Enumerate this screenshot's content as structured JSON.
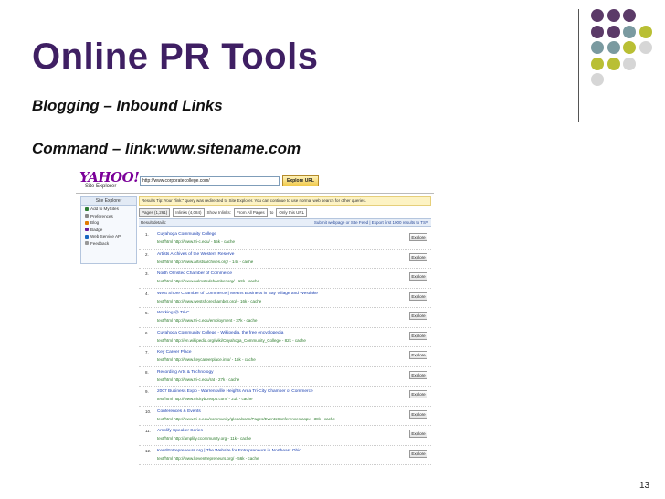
{
  "slide": {
    "title": "Online PR Tools",
    "subtitle1": "Blogging – Inbound Links",
    "subtitle2": "Command – link:www.sitename.com",
    "page_number": "13"
  },
  "decor": {
    "dot_colors": [
      [
        "#5b3a68",
        "#5b3a68",
        "#5b3a68",
        null
      ],
      [
        "#5b3a68",
        "#5b3a68",
        "#7a9aa0",
        "#b9bf34"
      ],
      [
        "#7a9aa0",
        "#7a9aa0",
        "#b9bf34",
        "#d6d6d6"
      ],
      [
        "#b9bf34",
        "#b9bf34",
        "#d6d6d6",
        null
      ],
      [
        "#d6d6d6",
        null,
        null,
        null
      ]
    ]
  },
  "screenshot": {
    "logo_word": "YAHOO!",
    "logo_sub": "Site Explorer",
    "url_value": "http://www.corporatecollege.com/",
    "explore_url_label": "Explore URL",
    "nav_title": "Site Explorer",
    "nav_items": [
      {
        "label": "Add to MySites",
        "color": "#2e7d32"
      },
      {
        "label": "Preferences",
        "color": "#888888"
      },
      {
        "label": "Blog",
        "color": "#e07a00"
      },
      {
        "label": "Badge",
        "color": "#6a1b9a"
      },
      {
        "label": "Web Service API",
        "color": "#1565c0"
      },
      {
        "label": "Feedback",
        "color": "#999999"
      }
    ],
    "results_notice": "Results   Tip: Your \"link:\" query was redirected to Site Explorer. You can continue to use normal web search for other queries.",
    "tabs": [
      "Pages (1,261)",
      "Inlinks (4,084)"
    ],
    "show_inlinks_label": "Show Inlinks:",
    "show_inlinks_value": "From All Pages",
    "to_label": "to",
    "scope_value": "Only this URL",
    "details_label": "Result details:",
    "details_right": "Submit webpage or Site Feed | Export first 1000 results to TSV",
    "results": [
      {
        "num": "1.",
        "title": "Cuyahoga Community College",
        "url": "text/html http://www.tri-c.edu/ - 55k - cache"
      },
      {
        "num": "2.",
        "title": "Artists Archives of the Western Reserve",
        "url": "text/html http://www.artistsarchives.org/ - 14k - cache"
      },
      {
        "num": "3.",
        "title": "North Olmsted Chamber of Commerce",
        "url": "text/html http://www.nolmstedchamber.org/ - 19k - cache"
      },
      {
        "num": "4.",
        "title": "West Shore Chamber of Commerce | Means Business in Bay Village and Westlake",
        "url": "text/html http://www.westshorechamber.org/ - 16k - cache"
      },
      {
        "num": "5.",
        "title": "Working @ Tri-C",
        "url": "text/html http://www.tri-c.edu/employment - 37k - cache"
      },
      {
        "num": "6.",
        "title": "Cuyahoga Community College - Wikipedia, the free encyclopedia",
        "url": "text/html http://en.wikipedia.org/wiki/Cuyahoga_Community_College - 82k - cache"
      },
      {
        "num": "7.",
        "title": "Key Career Place",
        "url": "text/html http://www.keycareerplace.info/ - 15k - cache"
      },
      {
        "num": "8.",
        "title": "Recording Arts & Technology",
        "url": "text/html http://www.tri-c.edu/rat - 27k - cache"
      },
      {
        "num": "9.",
        "title": "2007 Business Expo - Warrensville Heights Area Tri-City Chamber of Commerce",
        "url": "text/html http://www.tricitybizexpo.com/ - 21k - cache"
      },
      {
        "num": "10.",
        "title": "Conferences & Events",
        "url": "text/html http://www.tri-c.edu/community/globalscan/Pages/EventsConferences.aspx - 38k - cache"
      },
      {
        "num": "11.",
        "title": "Amplify Speaker Series",
        "url": "text/html http://amplify.ccommunity.org - 11k - cache"
      },
      {
        "num": "12.",
        "title": "Kent/Entrepreneurs.org | The Website for Entrepreneurs in Northeast Ohio",
        "url": "text/html http://www.keventrepreneurs.org/ - 56k - cache"
      }
    ],
    "explore_label": "Explore"
  }
}
